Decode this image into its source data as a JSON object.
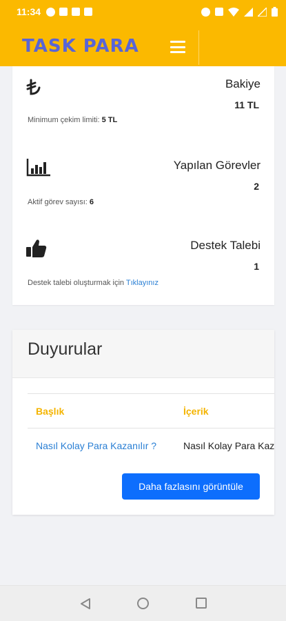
{
  "status_bar": {
    "time": "11:34",
    "left_icons": [
      "facebook-icon",
      "news-icon",
      "dollar-icon",
      "dollar-icon"
    ],
    "right_icons": [
      "alarm-icon",
      "volte-icon",
      "wifi-icon",
      "signal-icon",
      "signal-empty-icon",
      "battery-icon"
    ]
  },
  "header": {
    "logo_text": "TASK PARA",
    "brand_color": "#fbb900",
    "logo_color": "#5965d6"
  },
  "stats": [
    {
      "icon": "lira-icon",
      "title": "Bakiye",
      "value": "11 TL",
      "note_prefix": "Minimum çekim limiti: ",
      "note_value": "5 TL"
    },
    {
      "icon": "bar-chart-icon",
      "title": "Yapılan Görevler",
      "value": "2",
      "note_prefix": "Aktif görev sayısı: ",
      "note_value": "6"
    },
    {
      "icon": "thumbs-up-icon",
      "title": "Destek Talebi",
      "value": "1",
      "note_prefix": "Destek talebi oluşturmak için ",
      "note_link": "Tıklayınız"
    }
  ],
  "announcements": {
    "title": "Duyurular",
    "columns": [
      "Başlık",
      "İçerik"
    ],
    "rows": [
      {
        "title": "Nasıl Kolay Para Kazanılır ?",
        "content": "Nasıl Kolay Para Kazanılır"
      }
    ],
    "more_button": "Daha fazlasını görüntüle"
  }
}
